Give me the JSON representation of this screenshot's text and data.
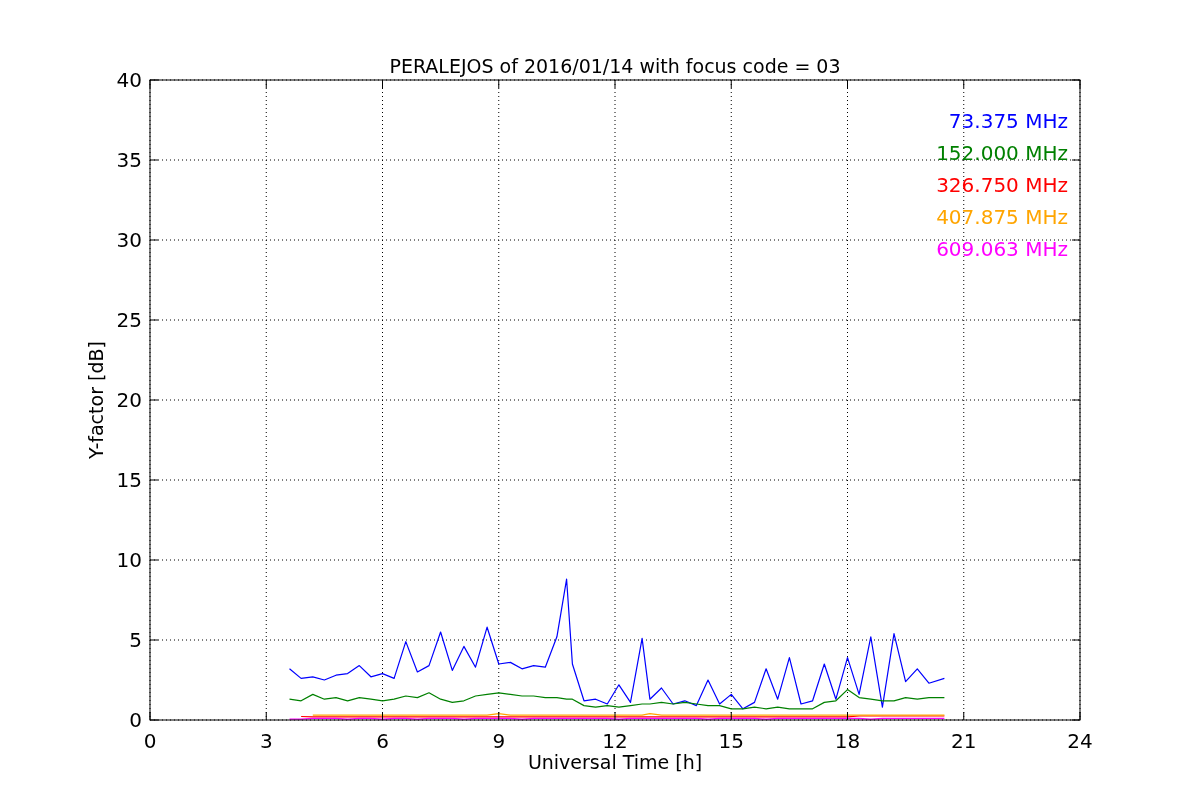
{
  "chart_data": {
    "type": "line",
    "title": "PERALEJOS of 2016/01/14 with focus code = 03",
    "xlabel": "Universal Time [h]",
    "ylabel": "Y-factor [dB]",
    "x": [
      3.6,
      3.9,
      4.2,
      4.5,
      4.8,
      5.1,
      5.4,
      5.7,
      6.0,
      6.3,
      6.6,
      6.9,
      7.2,
      7.5,
      7.8,
      8.1,
      8.4,
      8.7,
      9.0,
      9.3,
      9.6,
      9.9,
      10.2,
      10.5,
      10.75,
      10.9,
      11.2,
      11.5,
      11.8,
      12.1,
      12.4,
      12.7,
      12.9,
      13.2,
      13.5,
      13.8,
      14.1,
      14.4,
      14.7,
      15.0,
      15.3,
      15.6,
      15.9,
      16.2,
      16.5,
      16.8,
      17.1,
      17.4,
      17.7,
      18.0,
      18.3,
      18.6,
      18.9,
      19.2,
      19.5,
      19.8,
      20.1,
      20.5
    ],
    "series": [
      {
        "name": "73.375 MHz",
        "color": "#0000ff",
        "values": [
          3.2,
          2.6,
          2.7,
          2.5,
          2.8,
          2.9,
          3.4,
          2.7,
          2.9,
          2.6,
          4.9,
          3.0,
          3.4,
          5.5,
          3.1,
          4.6,
          3.3,
          5.8,
          3.5,
          3.6,
          3.2,
          3.4,
          3.3,
          5.2,
          8.8,
          3.5,
          1.2,
          1.3,
          1.0,
          2.2,
          1.1,
          5.1,
          1.3,
          2.0,
          1.0,
          1.2,
          0.9,
          2.5,
          1.0,
          1.6,
          0.7,
          1.1,
          3.2,
          1.3,
          3.9,
          1.0,
          1.2,
          3.5,
          1.3,
          3.9,
          1.6,
          5.2,
          0.8,
          5.4,
          2.4,
          3.2,
          2.3,
          2.6
        ]
      },
      {
        "name": "152.000 MHz",
        "color": "#008000",
        "values": [
          1.3,
          1.2,
          1.6,
          1.3,
          1.4,
          1.2,
          1.4,
          1.3,
          1.2,
          1.3,
          1.5,
          1.4,
          1.7,
          1.3,
          1.1,
          1.2,
          1.5,
          1.6,
          1.7,
          1.6,
          1.5,
          1.5,
          1.4,
          1.4,
          1.3,
          1.3,
          0.9,
          0.8,
          0.9,
          0.8,
          0.9,
          1.0,
          1.0,
          1.1,
          1.0,
          1.1,
          1.0,
          0.9,
          0.9,
          0.7,
          0.7,
          0.8,
          0.7,
          0.8,
          0.7,
          0.7,
          0.7,
          1.1,
          1.2,
          1.9,
          1.4,
          1.3,
          1.2,
          1.2,
          1.4,
          1.3,
          1.4,
          1.4
        ]
      },
      {
        "name": "326.750 MHz",
        "color": "#ff0000",
        "values": [
          null,
          0.22,
          0.2,
          0.2,
          0.2,
          0.2,
          0.2,
          0.2,
          0.2,
          0.2,
          0.2,
          0.2,
          0.2,
          0.2,
          0.2,
          0.2,
          0.2,
          0.2,
          0.2,
          0.2,
          0.2,
          0.2,
          0.2,
          0.2,
          0.2,
          0.2,
          0.2,
          0.2,
          0.2,
          0.2,
          0.2,
          0.2,
          0.2,
          0.2,
          0.2,
          0.2,
          0.2,
          0.2,
          0.2,
          0.2,
          0.2,
          0.2,
          0.2,
          0.2,
          0.2,
          0.2,
          0.2,
          0.2,
          0.2,
          0.2,
          0.25,
          0.25,
          0.25,
          0.25,
          0.25,
          0.25,
          0.25,
          0.25
        ]
      },
      {
        "name": "407.875 MHz",
        "color": "#ffa500",
        "values": [
          null,
          null,
          0.3,
          0.3,
          0.3,
          0.3,
          0.3,
          0.3,
          0.3,
          0.3,
          0.3,
          0.3,
          0.3,
          0.3,
          0.3,
          0.3,
          0.3,
          0.3,
          0.4,
          0.3,
          0.3,
          0.3,
          0.3,
          0.3,
          0.3,
          0.3,
          0.3,
          0.3,
          0.3,
          0.3,
          0.3,
          0.3,
          0.4,
          0.3,
          0.3,
          0.3,
          0.3,
          0.3,
          0.3,
          0.3,
          0.3,
          0.3,
          0.3,
          0.3,
          0.3,
          0.3,
          0.3,
          0.3,
          0.3,
          0.3,
          0.3,
          0.3,
          0.3,
          0.3,
          0.3,
          0.3,
          0.3,
          0.3
        ]
      },
      {
        "name": "609.063 MHz",
        "color": "#ff00ff",
        "values": [
          0.05,
          0.05,
          0.1,
          0.1,
          0.1,
          0.05,
          0.1,
          0.1,
          0.05,
          0.1,
          0.1,
          0.05,
          0.1,
          0.1,
          0.1,
          0.05,
          0.1,
          0.1,
          0.1,
          0.1,
          0.05,
          0.1,
          0.1,
          0.1,
          0.1,
          0.1,
          0.1,
          0.1,
          0.1,
          0.05,
          0.1,
          0.1,
          0.1,
          0.1,
          0.1,
          0.1,
          0.1,
          0.05,
          0.1,
          0.1,
          0.1,
          0.1,
          0.05,
          0.1,
          0.1,
          0.1,
          0.1,
          0.1,
          0.1,
          0.1,
          0.1,
          0.05,
          0.1,
          0.1,
          0.1,
          0.1,
          0.1,
          0.1
        ]
      }
    ],
    "xlim": [
      0,
      24
    ],
    "ylim": [
      0,
      40
    ],
    "xticks": [
      0,
      3,
      6,
      9,
      12,
      15,
      18,
      21,
      24
    ],
    "yticks": [
      0,
      5,
      10,
      15,
      20,
      25,
      30,
      35,
      40
    ],
    "grid": true
  }
}
